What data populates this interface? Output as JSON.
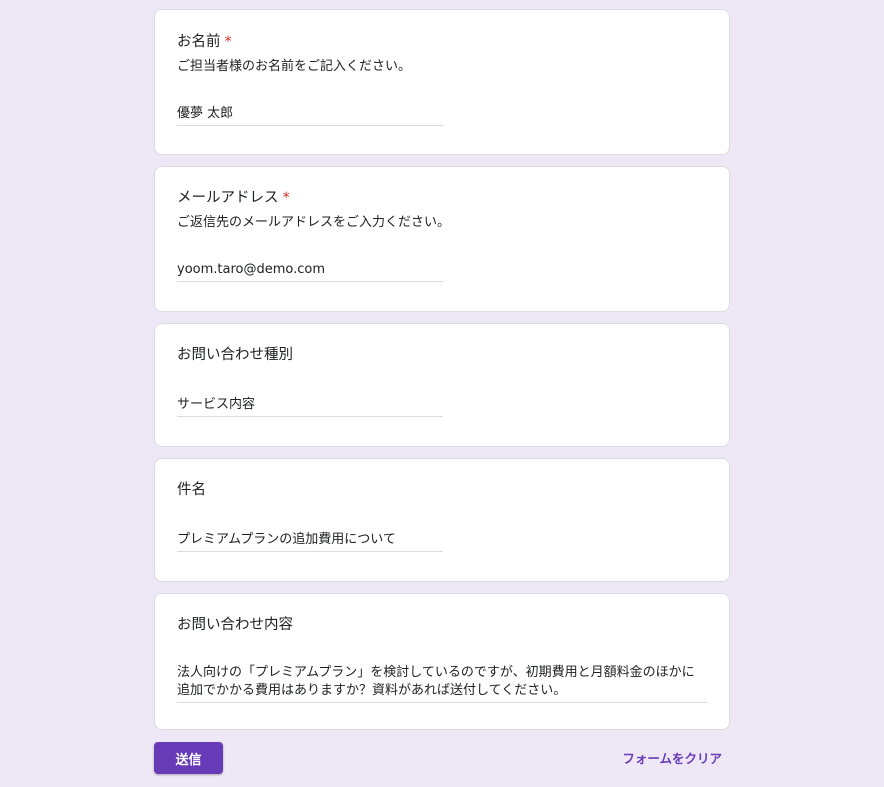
{
  "questions": [
    {
      "title": "お名前",
      "required_mark": "*",
      "description": "ご担当者様のお名前をご記入ください。",
      "answer": "優夢 太郎"
    },
    {
      "title": "メールアドレス",
      "required_mark": "*",
      "description": "ご返信先のメールアドレスをご入力ください。",
      "answer": "yoom.taro@demo.com"
    },
    {
      "title": "お問い合わせ種別",
      "answer": "サービス内容"
    },
    {
      "title": "件名",
      "answer": "プレミアムプランの追加費用について"
    },
    {
      "title": "お問い合わせ内容",
      "answer": "法人向けの「プレミアムプラン」を検討しているのですが、初期費用と月額料金のほかに追加でかかる費用はありますか？資料があれば送付してください。"
    }
  ],
  "actions": {
    "submit_label": "送信",
    "clear_label": "フォームをクリア"
  },
  "colors": {
    "background": "#ede7f6",
    "accent": "#673ab7",
    "required": "#d93025"
  }
}
